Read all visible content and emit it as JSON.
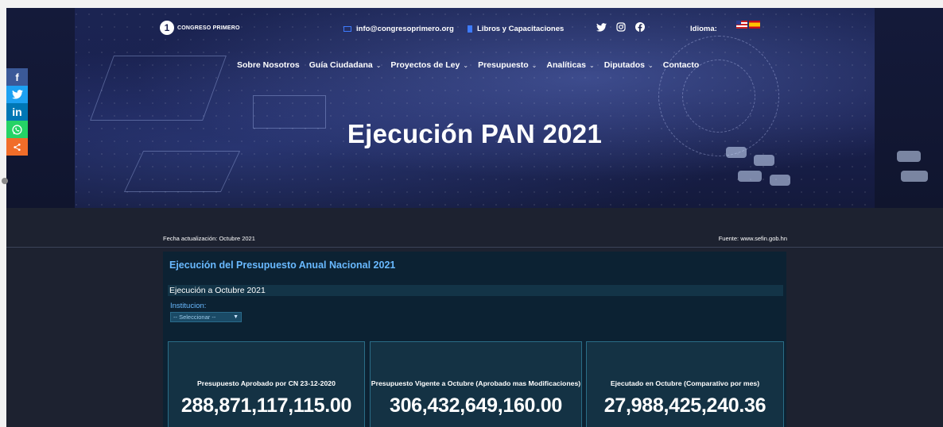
{
  "header": {
    "logo_text": "CONGRESO PRIMERO",
    "logo_mark": "1",
    "email": "info@congresoprimero.org",
    "books_link": "Libros y Capacitaciones",
    "language_label": "Idioma:",
    "social_icons": [
      "twitter-icon",
      "instagram-icon",
      "facebook-icon"
    ]
  },
  "nav": {
    "items": [
      {
        "label": "Sobre Nosotros",
        "has_dropdown": false
      },
      {
        "label": "Guía Ciudadana",
        "has_dropdown": true
      },
      {
        "label": "Proyectos de Ley",
        "has_dropdown": true
      },
      {
        "label": "Presupuesto",
        "has_dropdown": true
      },
      {
        "label": "Analíticas",
        "has_dropdown": true
      },
      {
        "label": "Diputados",
        "has_dropdown": true
      },
      {
        "label": "Contacto",
        "has_dropdown": false
      }
    ],
    "chevron": "⌄"
  },
  "hero": {
    "title": "Ejecución PAN 2021"
  },
  "share": {
    "buttons": [
      {
        "icon": "facebook-icon",
        "glyph": "f"
      },
      {
        "icon": "twitter-icon",
        "glyph": "🐦"
      },
      {
        "icon": "linkedin-icon",
        "glyph": "in"
      },
      {
        "icon": "whatsapp-icon",
        "glyph": "✆"
      },
      {
        "icon": "share-icon",
        "glyph": "<"
      }
    ]
  },
  "meta": {
    "updated": "Fecha actualización: Octubre 2021",
    "source": "Fuente: www.sefin.gob.hn"
  },
  "panel": {
    "title": "Ejecución del Presupuesto Anual Nacional 2021",
    "subheader": "Ejecución a Octubre 2021",
    "institution_label": "Institucion:",
    "institution_value": "-- Seleccionar --",
    "cards": [
      {
        "label": "Presupuesto Aprobado por CN 23-12-2020",
        "value": "288,871,117,115.00"
      },
      {
        "label": "Presupuesto Vigente a Octubre (Aprobado mas Modificaciones)",
        "value": "306,432,649,160.00"
      },
      {
        "label": "Ejecutado en Octubre (Comparativo por mes)",
        "value": "27,988,425,240.36"
      }
    ]
  },
  "colors": {
    "accent_blue": "#69b9ff",
    "panel_bg": "#0c2233",
    "card_bg": "#143244"
  }
}
